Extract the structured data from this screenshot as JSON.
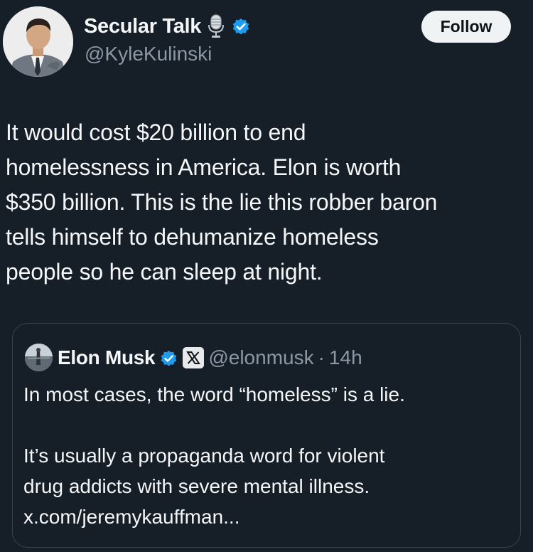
{
  "author": {
    "display_name": "Secular Talk",
    "handle": "@KyleKulinski",
    "follow_label": "Follow",
    "badge_icon": "microphone-icon",
    "verified_icon": "verified-badge-icon"
  },
  "tweet": {
    "lines": [
      "It would cost $20 billion to end",
      "homelessness in America. Elon is worth",
      "$350 billion. This is the lie this robber baron",
      "tells himself to dehumanize homeless",
      "people so he can sleep at night."
    ]
  },
  "quote": {
    "display_name": "Elon Musk",
    "verified_icon": "verified-badge-icon",
    "affiliate_icon": "x-logo-icon",
    "handle": "@elonmusk",
    "separator": "·",
    "time": "14h",
    "paragraph1": "In most cases, the word “homeless” is a lie.",
    "paragraph2_lines": [
      "It’s usually a propaganda word for violent",
      "drug addicts with severe mental illness.",
      "x.com/jeremykauffman..."
    ]
  },
  "colors": {
    "background": "#161e27",
    "verified_blue": "#1d9bf0",
    "secondary_text": "#8b98a5",
    "primary_text": "#f4f6f8",
    "border": "#38444d"
  }
}
